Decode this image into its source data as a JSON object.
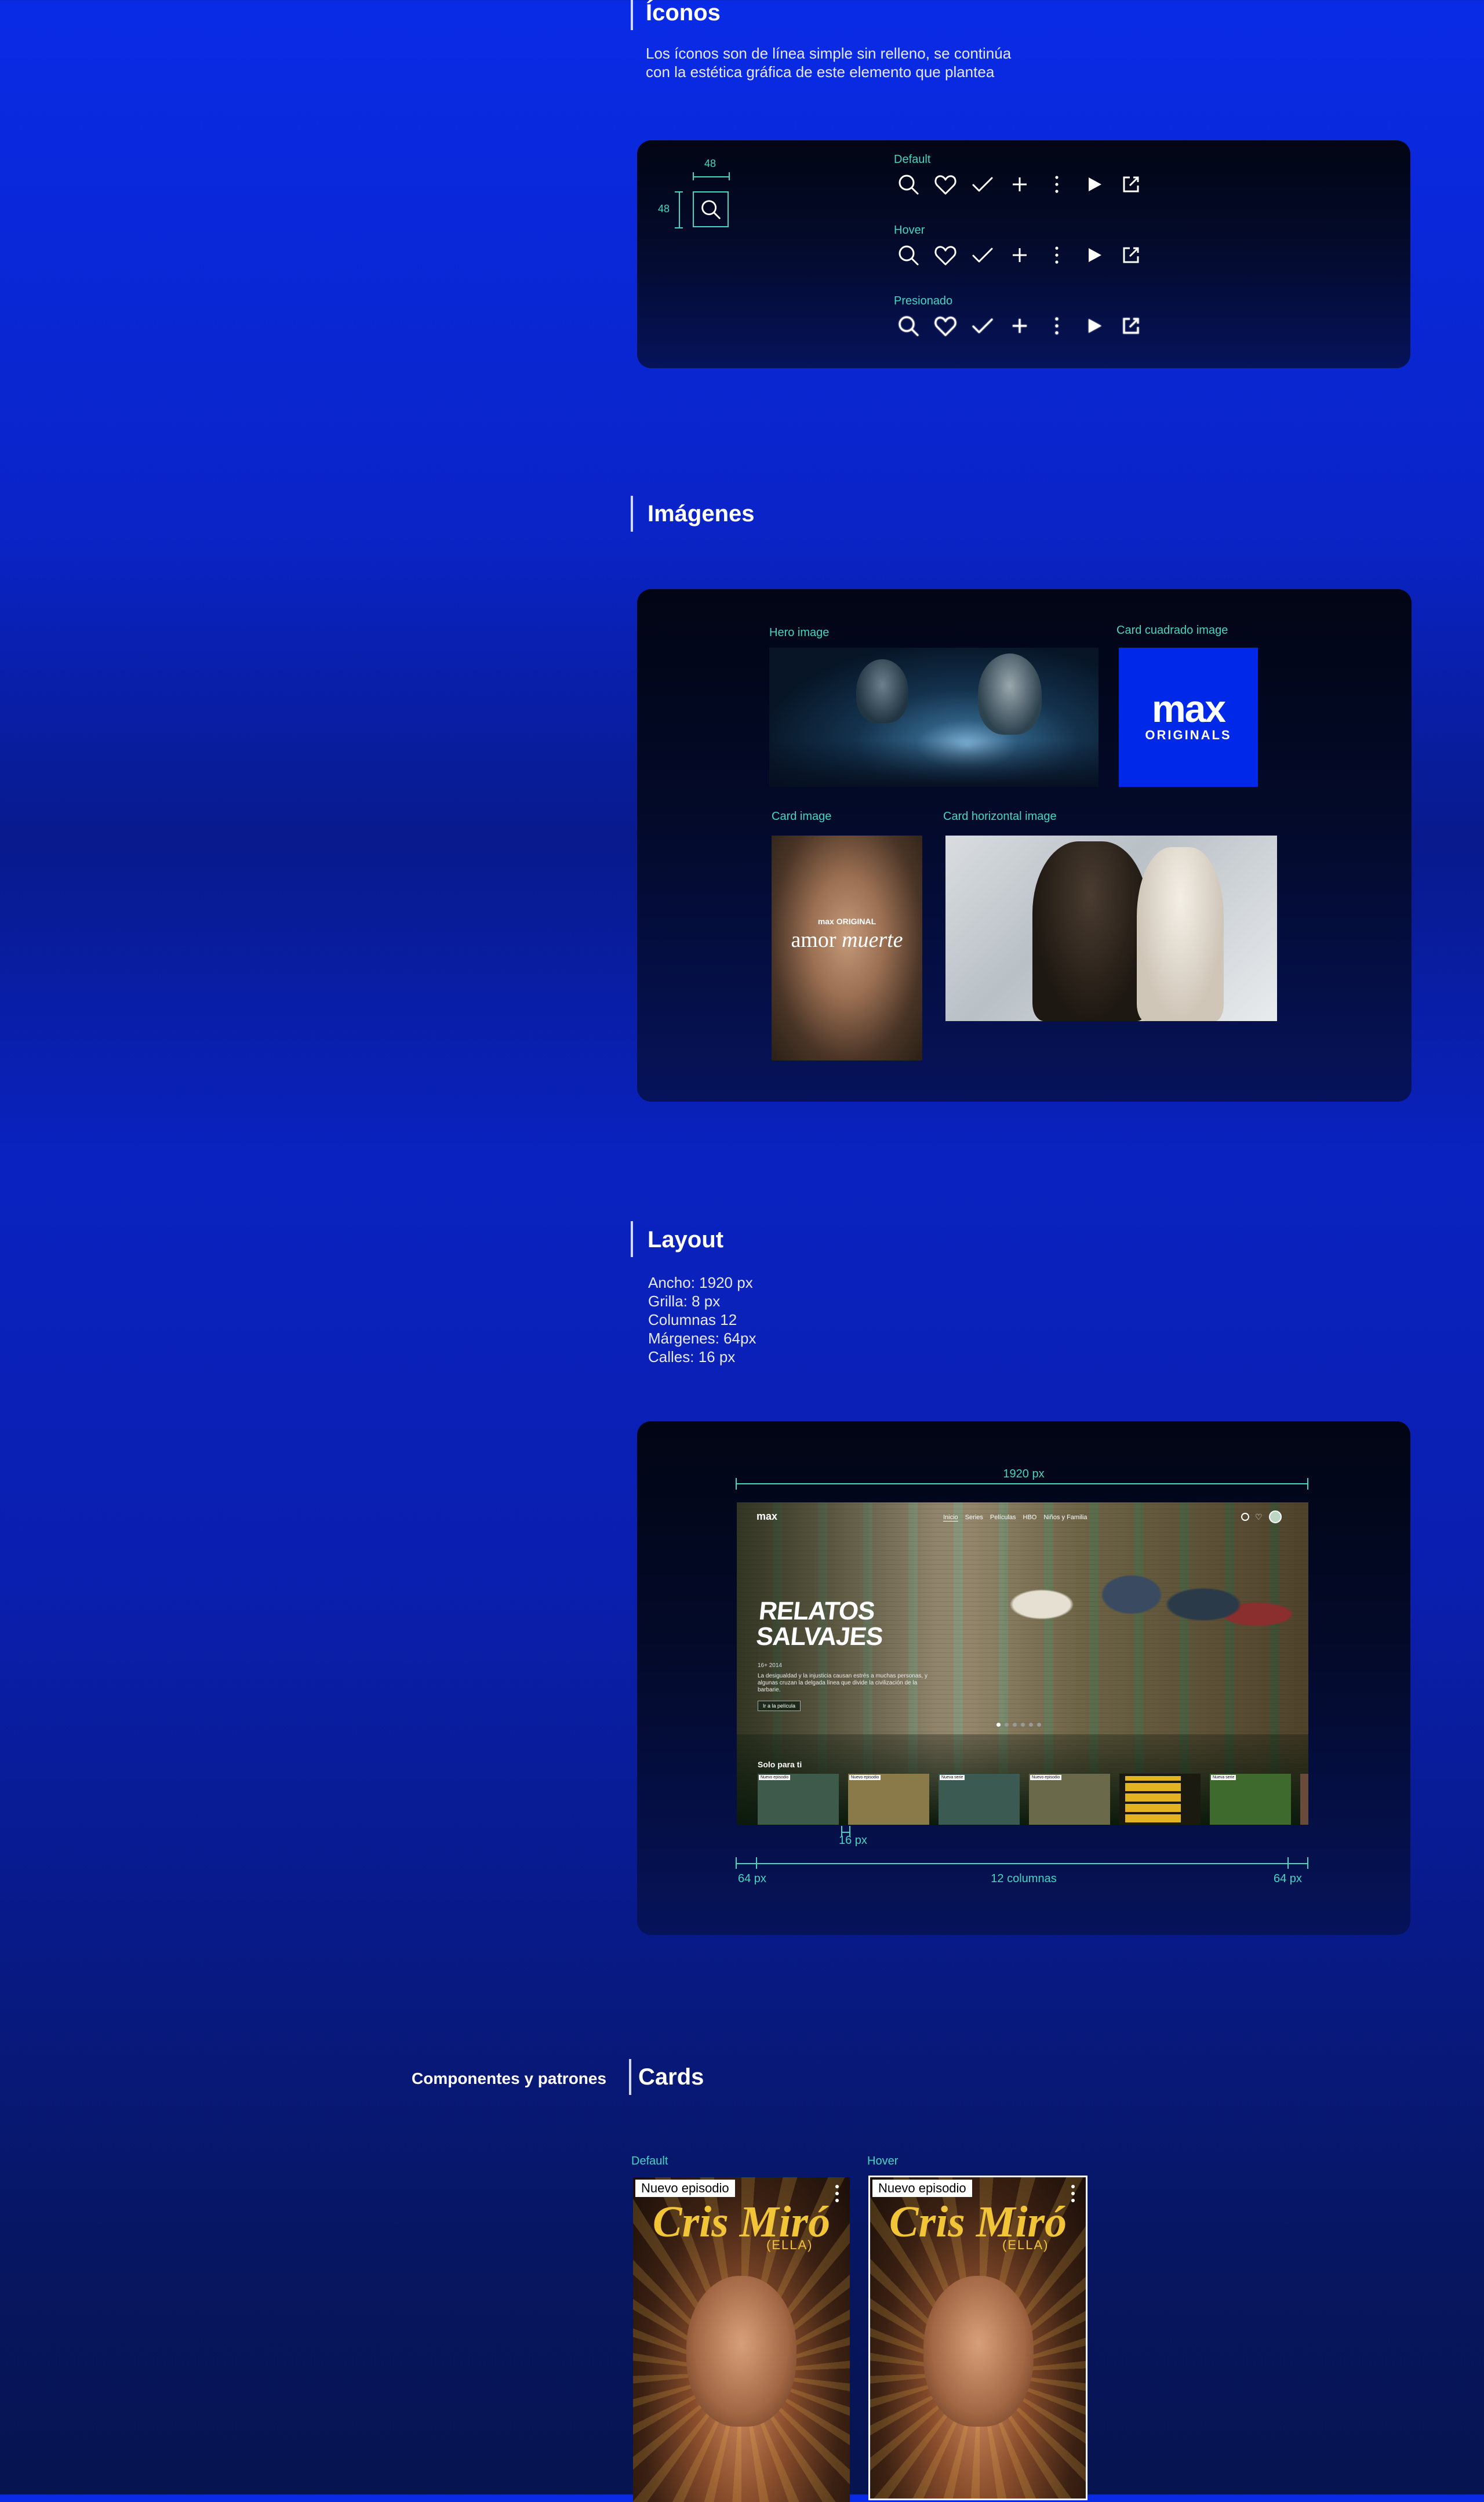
{
  "iconos": {
    "title": "Íconos",
    "description_line1": "Los íconos son de línea simple sin relleno, se continúa",
    "description_line2": "con la estética gráfica de este elemento que plantea",
    "size_w": "48",
    "size_h": "48",
    "states": [
      "Default",
      "Hover",
      "Presionado"
    ],
    "icon_names": [
      "search-icon",
      "heart-icon",
      "check-icon",
      "plus-icon",
      "more-vertical-icon",
      "play-icon",
      "external-link-icon"
    ]
  },
  "imagenes": {
    "title": "Imágenes",
    "hero_label": "Hero image",
    "card_square_label": "Card cuadrado image",
    "card_label": "Card image",
    "card_horizontal_label": "Card horizontal image",
    "max_logo": "max",
    "max_originals": "ORIGINALS",
    "poster_brand": "max ORIGINAL",
    "poster_title_1": "amor",
    "poster_title_2": "muerte"
  },
  "layout": {
    "title": "Layout",
    "specs": [
      "Ancho: 1920 px",
      "Grilla: 8 px",
      "Columnas 12",
      "Márgenes: 64px",
      "Calles: 16 px"
    ],
    "width_label": "1920 px",
    "gutter_label": "16 px",
    "margin_left_label": "64 px",
    "columns_label": "12 columnas",
    "margin_right_label": "64 px",
    "mock": {
      "logo": "max",
      "nav": [
        "Inicio",
        "Series",
        "Películas",
        "HBO",
        "Niños y Familia"
      ],
      "hero_title_1": "RELATOS",
      "hero_title_2": "SALVAJES",
      "hero_meta": "16+  2014",
      "hero_desc": "La desigualdad y la injusticia causan estrés a muchas personas, y algunas cruzan la delgada línea que divide la civilización de la barbarie.",
      "hero_button": "Ir a la película",
      "row_title": "Solo para ti",
      "row_badges": [
        "Nuevo episodio",
        "Nuevo episodio",
        "Nueva serie",
        "Nuevo episodio",
        "",
        "Nueva serie",
        ""
      ]
    }
  },
  "cards": {
    "section_label": "Componentes y patrones",
    "title": "Cards",
    "state_default": "Default",
    "state_hover": "Hover",
    "badge": "Nuevo episodio",
    "poster_title": "Cris Miró",
    "poster_subtitle": "(ELLA)"
  },
  "colors": {
    "accent": "#45d6c0",
    "max_blue": "#0028e8",
    "badge_bg": "#ffffff"
  }
}
